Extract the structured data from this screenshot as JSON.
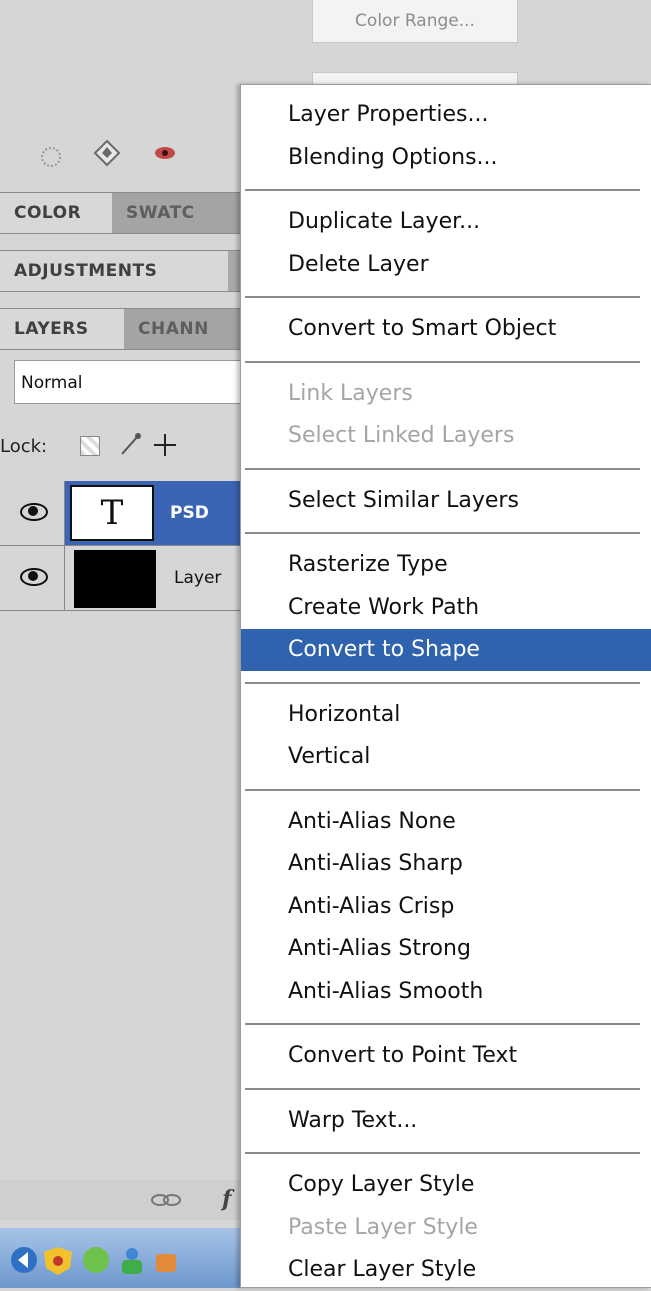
{
  "top_button": "Color Range...",
  "panels": {
    "color_tabs": [
      "COLOR",
      "SWATC"
    ],
    "adjustments_tab": "ADJUSTMENTS",
    "layers_tabs": [
      "LAYERS",
      "CHANN"
    ]
  },
  "blend_mode": "Normal",
  "lock_label": "Lock:",
  "layers": [
    {
      "thumb": "T",
      "name": "PSD",
      "selected": true
    },
    {
      "thumb": "",
      "name": "Layer",
      "selected": false
    }
  ],
  "menu": {
    "groups": [
      [
        {
          "label": "Layer Properties..."
        },
        {
          "label": "Blending Options..."
        }
      ],
      [
        {
          "label": "Duplicate Layer..."
        },
        {
          "label": "Delete Layer"
        }
      ],
      [
        {
          "label": "Convert to Smart Object"
        }
      ],
      [
        {
          "label": "Link Layers",
          "disabled": true
        },
        {
          "label": "Select Linked Layers",
          "disabled": true
        }
      ],
      [
        {
          "label": "Select Similar Layers"
        }
      ],
      [
        {
          "label": "Rasterize Type"
        },
        {
          "label": "Create Work Path"
        },
        {
          "label": "Convert to Shape",
          "selected": true
        }
      ],
      [
        {
          "label": "Horizontal"
        },
        {
          "label": "Vertical"
        }
      ],
      [
        {
          "label": "Anti-Alias None"
        },
        {
          "label": "Anti-Alias Sharp"
        },
        {
          "label": "Anti-Alias Crisp"
        },
        {
          "label": "Anti-Alias Strong"
        },
        {
          "label": "Anti-Alias Smooth"
        }
      ],
      [
        {
          "label": "Convert to Point Text"
        }
      ],
      [
        {
          "label": "Warp Text..."
        }
      ],
      [
        {
          "label": "Copy Layer Style"
        },
        {
          "label": "Paste Layer Style",
          "disabled": true
        },
        {
          "label": "Clear Layer Style"
        }
      ]
    ]
  },
  "colors": {
    "menu_highlight": "#2f63b0",
    "layer_selected": "#3b65b2"
  }
}
